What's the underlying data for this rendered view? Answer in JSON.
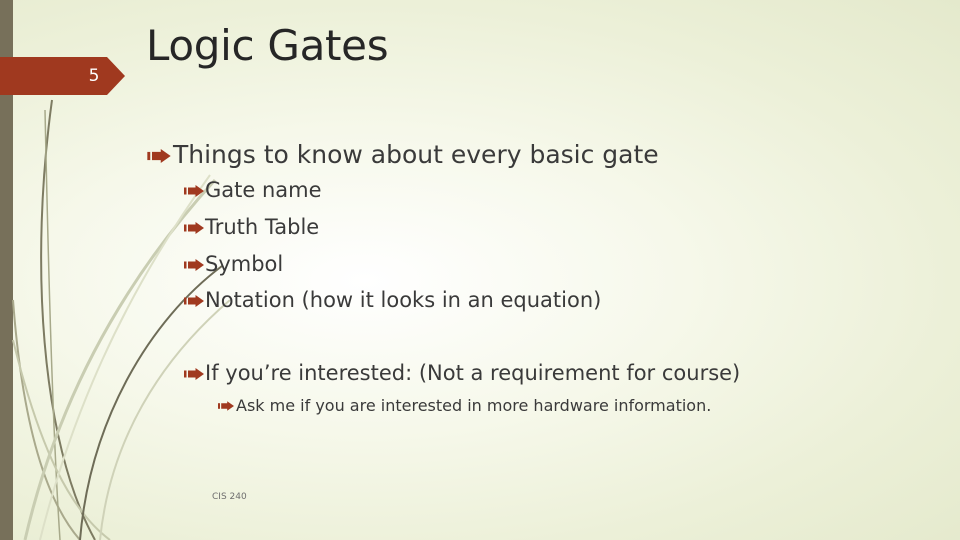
{
  "slide": {
    "number": "5",
    "title": "Logic Gates",
    "footer": "CIS 240",
    "accent_color": "#a0391f",
    "strip_color": "#77705a"
  },
  "content": {
    "bullets": [
      {
        "level": 1,
        "icon": "arrow-right-icon",
        "text": "Things to know about every basic gate"
      },
      {
        "level": 2,
        "icon": "arrow-right-icon",
        "text": "Gate name"
      },
      {
        "level": 2,
        "icon": "arrow-right-icon",
        "text": "Truth Table"
      },
      {
        "level": 2,
        "icon": "arrow-right-icon",
        "text": "Symbol"
      },
      {
        "level": 2,
        "icon": "arrow-right-icon",
        "text": "Notation (how it looks in an equation)"
      },
      {
        "level": 2,
        "icon": "arrow-right-icon",
        "text": "If you’re interested: (Not a requirement for course)"
      },
      {
        "level": 3,
        "icon": "arrow-right-icon",
        "text": "Ask me if you are interested in more hardware information."
      }
    ]
  }
}
